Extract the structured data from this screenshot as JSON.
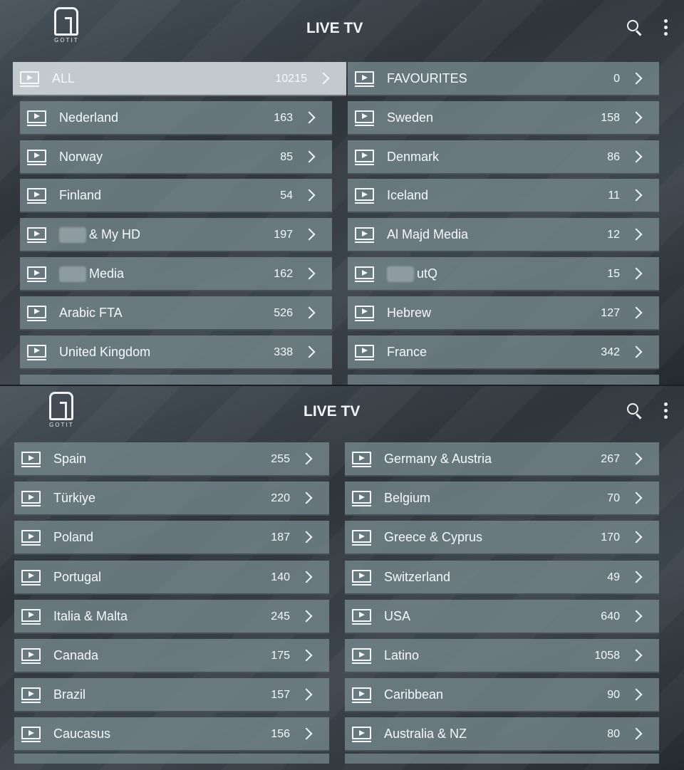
{
  "top": {
    "logo_text": "GOTIT",
    "title": "LIVE TV",
    "left_column": [
      {
        "label": "ALL",
        "count": "10215",
        "selected": true
      },
      {
        "label": "Nederland",
        "count": "163"
      },
      {
        "label": "Norway",
        "count": "85"
      },
      {
        "label": "Finland",
        "count": "54"
      },
      {
        "label": "& My HD",
        "count": "197",
        "redacted_prefix": true
      },
      {
        "label": "Media",
        "count": "162",
        "redacted_prefix": true
      },
      {
        "label": "Arabic FTA",
        "count": "526"
      },
      {
        "label": "United Kingdom",
        "count": "338"
      }
    ],
    "right_column": [
      {
        "label": "FAVOURITES",
        "count": "0"
      },
      {
        "label": "Sweden",
        "count": "158"
      },
      {
        "label": "Denmark",
        "count": "86"
      },
      {
        "label": "Iceland",
        "count": "11"
      },
      {
        "label": "Al Majd Media",
        "count": "12"
      },
      {
        "label": "utQ",
        "count": "15",
        "redacted_prefix": true
      },
      {
        "label": "Hebrew",
        "count": "127"
      },
      {
        "label": "France",
        "count": "342"
      }
    ]
  },
  "bottom": {
    "logo_text": "GOTIT",
    "title": "LIVE TV",
    "left_column": [
      {
        "label": "Spain",
        "count": "255"
      },
      {
        "label": "Türkiye",
        "count": "220"
      },
      {
        "label": "Poland",
        "count": "187"
      },
      {
        "label": "Portugal",
        "count": "140"
      },
      {
        "label": "Italia & Malta",
        "count": "245"
      },
      {
        "label": "Canada",
        "count": "175"
      },
      {
        "label": "Brazil",
        "count": "157"
      },
      {
        "label": "Caucasus",
        "count": "156"
      }
    ],
    "right_column": [
      {
        "label": "Germany & Austria",
        "count": "267"
      },
      {
        "label": "Belgium",
        "count": "70"
      },
      {
        "label": "Greece & Cyprus",
        "count": "170"
      },
      {
        "label": "Switzerland",
        "count": "49"
      },
      {
        "label": "USA",
        "count": "640"
      },
      {
        "label": "Latino",
        "count": "1058"
      },
      {
        "label": "Caribbean",
        "count": "90"
      },
      {
        "label": "Australia & NZ",
        "count": "80"
      }
    ]
  },
  "icons": {
    "logo": "gotit-logo-icon",
    "search": "search-icon",
    "menu": "more-vertical-icon",
    "category": "tv-play-icon",
    "chevron": "chevron-right-icon"
  },
  "colors": {
    "tile": "#74878c",
    "tile_selected": "#cdd4d7",
    "text": "#f7f8f9"
  }
}
